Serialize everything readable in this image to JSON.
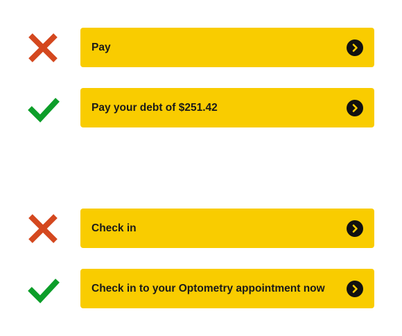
{
  "colors": {
    "button_bg": "#F9CC00",
    "button_text": "#1a1a1a",
    "wrong_mark": "#D4481F",
    "right_mark": "#0D9E2A",
    "chevron_circle": "#111111"
  },
  "examples": [
    {
      "verdict": "incorrect",
      "indicator_icon": "cross-icon",
      "label": "Pay",
      "trailing_icon": "chevron-right-circle-icon"
    },
    {
      "verdict": "correct",
      "indicator_icon": "check-icon",
      "label": "Pay your debt of $251.42",
      "trailing_icon": "chevron-right-circle-icon"
    },
    {
      "verdict": "incorrect",
      "indicator_icon": "cross-icon",
      "label": "Check in",
      "trailing_icon": "chevron-right-circle-icon"
    },
    {
      "verdict": "correct",
      "indicator_icon": "check-icon",
      "label": "Check in to your Optometry appointment now",
      "trailing_icon": "chevron-right-circle-icon"
    }
  ]
}
